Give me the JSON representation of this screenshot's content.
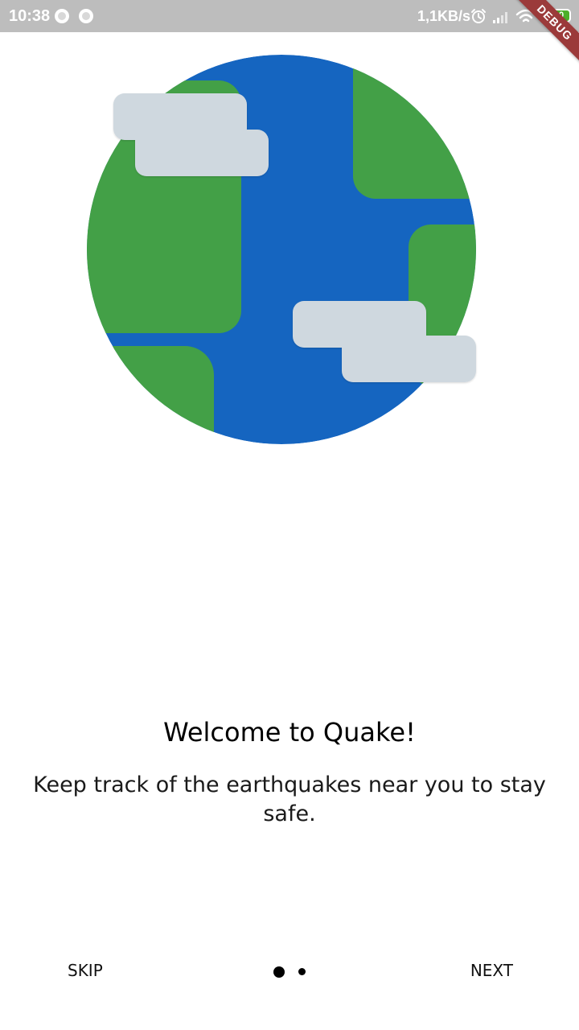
{
  "status_bar": {
    "time": "10:38",
    "network_speed": "1,1KB/s",
    "battery_level": "100",
    "icons": [
      "record-icon",
      "record-icon",
      "alarm-icon",
      "signal-icon",
      "wifi-icon",
      "battery-icon"
    ]
  },
  "debug_banner": {
    "label": "DEBUG",
    "color": "#9b3a3a"
  },
  "illustration": {
    "name": "earth-globe-illustration",
    "colors": {
      "ocean": "#1565c0",
      "land": "#43a047",
      "clouds": "#cfd8df"
    }
  },
  "onboarding": {
    "title": "Welcome to Quake!",
    "description": "Keep track of the earthquakes near you to stay safe."
  },
  "navigation": {
    "skip_label": "SKIP",
    "next_label": "NEXT",
    "page_count": 2,
    "current_page": 1
  }
}
